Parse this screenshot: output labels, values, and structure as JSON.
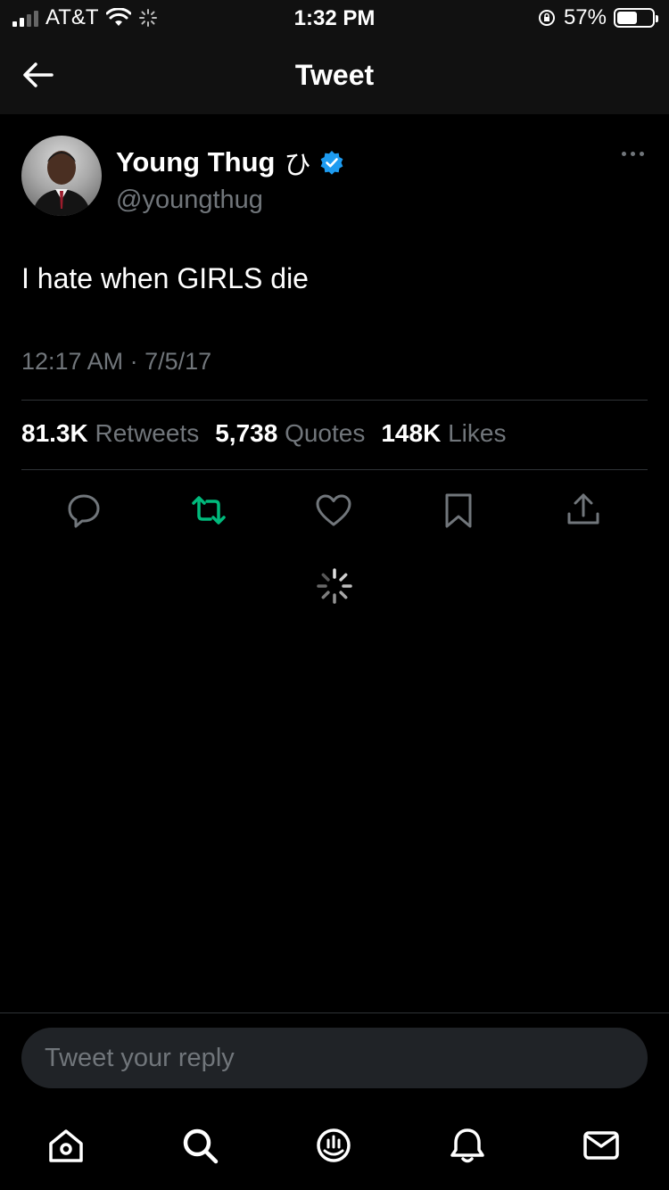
{
  "status_bar": {
    "carrier": "AT&T",
    "time": "1:32 PM",
    "battery": "57%",
    "battery_level": 0.57
  },
  "nav": {
    "title": "Tweet"
  },
  "tweet": {
    "author_name": "Young Thug",
    "name_glyph": "ひ",
    "handle": "@youngthug",
    "text": "I hate when GIRLS die",
    "timestamp": "12:17 AM · 7/5/17"
  },
  "stats": [
    {
      "value": "81.3K",
      "label": "Retweets"
    },
    {
      "value": "5,738",
      "label": "Quotes"
    },
    {
      "value": "148K",
      "label": "Likes"
    }
  ],
  "actions": [
    "reply-icon",
    "retweet-icon",
    "like-icon",
    "bookmark-icon",
    "share-icon"
  ],
  "reply": {
    "placeholder": "Tweet your reply"
  },
  "tabs": [
    "home-icon",
    "search-icon",
    "spaces-icon",
    "notifications-icon",
    "messages-icon"
  ],
  "colors": {
    "background": "#000000",
    "secondary_text": "#71767b",
    "verified": "#1d9bf0",
    "retweet_green": "#00ba7c",
    "divider": "#2f3336"
  }
}
